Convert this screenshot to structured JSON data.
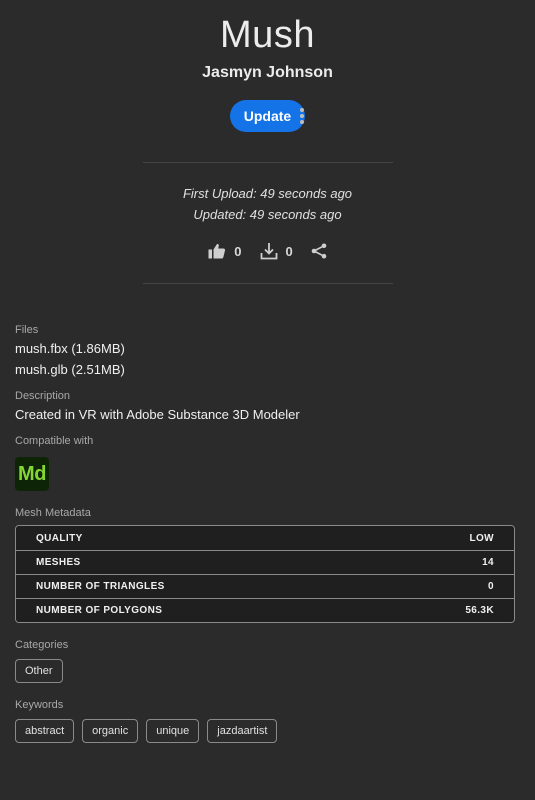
{
  "asset": {
    "title": "Mush",
    "author": "Jasmyn Johnson",
    "update_label": "Update"
  },
  "dates": {
    "first_upload": "First Upload: 49 seconds ago",
    "updated": "Updated: 49 seconds ago"
  },
  "stats": {
    "likes": "0",
    "downloads": "0"
  },
  "files": {
    "label": "Files",
    "items": [
      "mush.fbx (1.86MB)",
      "mush.glb (2.51MB)"
    ]
  },
  "description": {
    "label": "Description",
    "text": "Created in VR with Adobe Substance 3D Modeler"
  },
  "compatible": {
    "label": "Compatible with",
    "app_abbrev": "Md",
    "app_icon": "substance-modeler-icon",
    "app_color": "#86d633"
  },
  "mesh": {
    "label": "Mesh Metadata",
    "rows": [
      {
        "key": "QUALITY",
        "value": "LOW"
      },
      {
        "key": "MESHES",
        "value": "14"
      },
      {
        "key": "NUMBER OF TRIANGLES",
        "value": "0"
      },
      {
        "key": "NUMBER OF POLYGONS",
        "value": "56.3K"
      }
    ]
  },
  "categories": {
    "label": "Categories",
    "items": [
      "Other"
    ]
  },
  "keywords": {
    "label": "Keywords",
    "items": [
      "abstract",
      "organic",
      "unique",
      "jazdaartist"
    ]
  },
  "colors": {
    "background": "#2b2b2b",
    "accent": "#1473e6"
  }
}
